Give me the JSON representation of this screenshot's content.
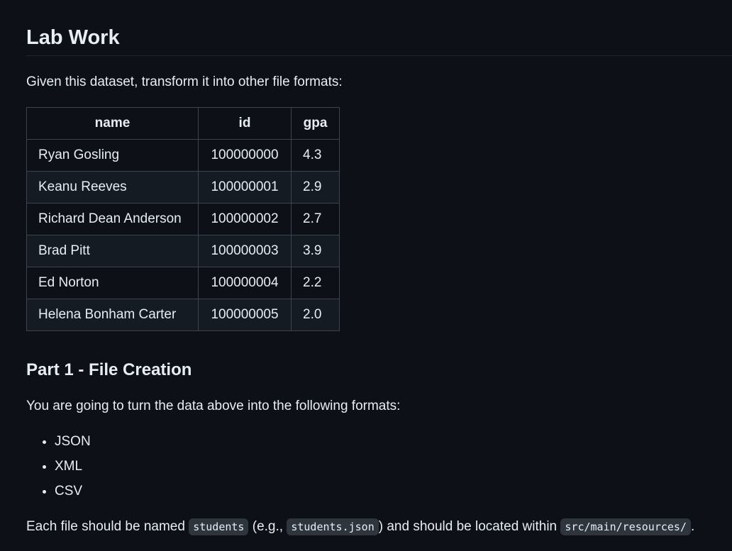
{
  "section": {
    "title": "Lab Work",
    "intro": "Given this dataset, transform it into other file formats:"
  },
  "table": {
    "headers": [
      "name",
      "id",
      "gpa"
    ],
    "rows": [
      [
        "Ryan Gosling",
        "100000000",
        "4.3"
      ],
      [
        "Keanu Reeves",
        "100000001",
        "2.9"
      ],
      [
        "Richard Dean Anderson",
        "100000002",
        "2.7"
      ],
      [
        "Brad Pitt",
        "100000003",
        "3.9"
      ],
      [
        "Ed Norton",
        "100000004",
        "2.2"
      ],
      [
        "Helena Bonham Carter",
        "100000005",
        "2.0"
      ]
    ]
  },
  "part1": {
    "title": "Part 1 - File Creation",
    "description": "You are going to turn the data above into the following formats:",
    "formats": [
      "JSON",
      "XML",
      "CSV"
    ],
    "naming": {
      "text1": "Each file should be named ",
      "code1": "students",
      "text2": " (e.g., ",
      "code2": "students.json",
      "text3": ") and should be located within ",
      "code3": "src/main/resources/",
      "text4": "."
    }
  }
}
